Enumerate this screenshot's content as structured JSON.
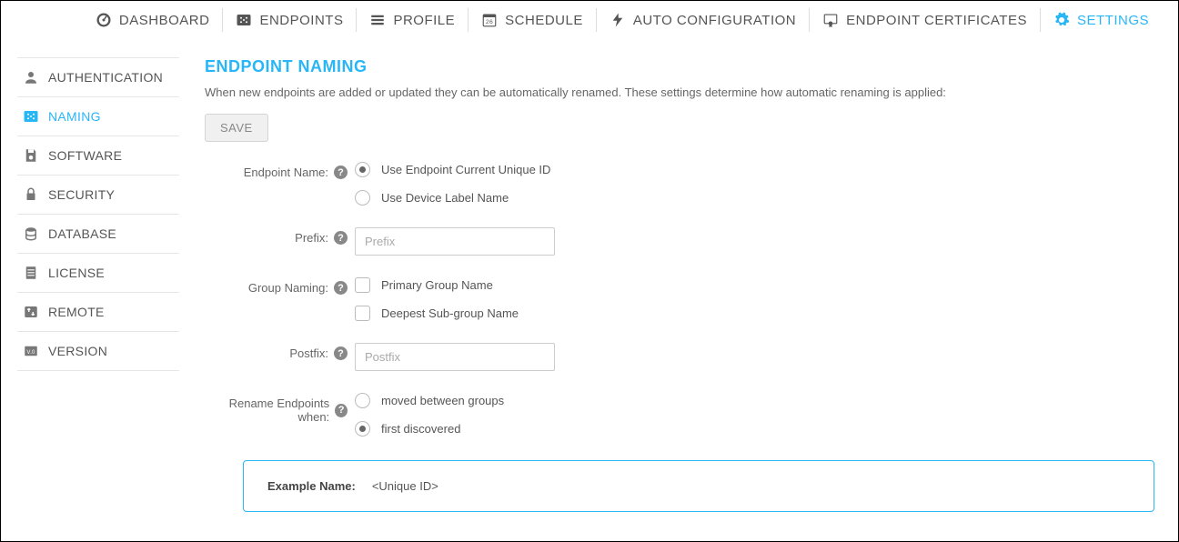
{
  "topnav": {
    "items": [
      {
        "label": "DASHBOARD"
      },
      {
        "label": "ENDPOINTS"
      },
      {
        "label": "PROFILE"
      },
      {
        "label": "SCHEDULE"
      },
      {
        "label": "AUTO CONFIGURATION"
      },
      {
        "label": "ENDPOINT CERTIFICATES"
      },
      {
        "label": "SETTINGS"
      }
    ],
    "schedule_day": "26"
  },
  "sidebar": {
    "items": [
      {
        "label": "AUTHENTICATION"
      },
      {
        "label": "NAMING"
      },
      {
        "label": "SOFTWARE"
      },
      {
        "label": "SECURITY"
      },
      {
        "label": "DATABASE"
      },
      {
        "label": "LICENSE"
      },
      {
        "label": "REMOTE"
      },
      {
        "label": "VERSION"
      }
    ]
  },
  "page": {
    "title": "ENDPOINT NAMING",
    "description": "When new endpoints are added or updated they can be automatically renamed. These settings determine how automatic renaming is applied:",
    "save_label": "SAVE"
  },
  "form": {
    "endpoint_name_label": "Endpoint Name:",
    "endpoint_name_opts": [
      {
        "label": "Use Endpoint Current Unique ID",
        "checked": true
      },
      {
        "label": "Use Device Label Name",
        "checked": false
      }
    ],
    "prefix_label": "Prefix:",
    "prefix_placeholder": "Prefix",
    "group_naming_label": "Group Naming:",
    "group_naming_opts": [
      {
        "label": "Primary Group Name",
        "checked": false
      },
      {
        "label": "Deepest Sub-group Name",
        "checked": false
      }
    ],
    "postfix_label": "Postfix:",
    "postfix_placeholder": "Postfix",
    "rename_when_label": "Rename Endpoints when:",
    "rename_when_opts": [
      {
        "label": "moved between groups",
        "checked": false
      },
      {
        "label": "first discovered",
        "checked": true
      }
    ]
  },
  "example": {
    "label": "Example Name:",
    "value": "<Unique ID>"
  },
  "help_glyph": "?"
}
